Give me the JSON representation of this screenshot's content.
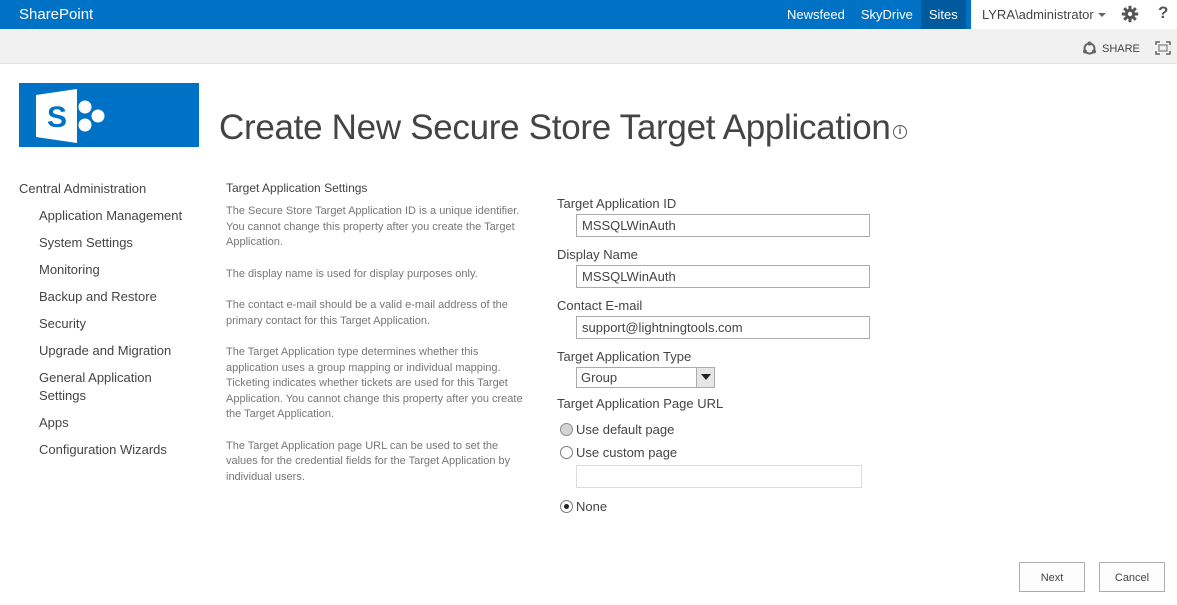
{
  "suite_bar": {
    "brand": "SharePoint",
    "links": [
      "Newsfeed",
      "SkyDrive",
      "Sites"
    ],
    "active_link": "Sites",
    "user": "LYRA\\administrator",
    "help": "?"
  },
  "ribbon": {
    "share_label": "SHARE"
  },
  "page": {
    "title": "Create New Secure Store Target Application"
  },
  "left_nav": {
    "root": "Central Administration",
    "items": [
      "Application Management",
      "System Settings",
      "Monitoring",
      "Backup and Restore",
      "Security",
      "Upgrade and Migration",
      "General Application Settings",
      "Apps",
      "Configuration Wizards"
    ]
  },
  "description": {
    "title": "Target Application Settings",
    "paragraphs": [
      "The Secure Store Target Application ID is a unique identifier. You cannot change this property after you create the Target Application.",
      "The display name is used for display purposes only.",
      "The contact e-mail should be a valid e-mail address of the primary contact for this Target Application.",
      "The Target Application type determines whether this application uses a group mapping or individual mapping. Ticketing indicates whether tickets are used for this Target Application. You cannot change this property after you create the Target Application.",
      "The Target Application page URL can be used to set the values for the credential fields for the Target Application by individual users."
    ]
  },
  "form": {
    "app_id_label": "Target Application ID",
    "app_id_value": "MSSQLWinAuth",
    "display_name_label": "Display Name",
    "display_name_value": "MSSQLWinAuth",
    "email_label": "Contact E-mail",
    "email_value": "support@lightningtools.com",
    "type_label": "Target Application Type",
    "type_value": "Group",
    "page_url_label": "Target Application Page URL",
    "radio_default": "Use default page",
    "radio_custom": "Use custom page",
    "radio_none": "None",
    "selected_radio": "None"
  },
  "buttons": {
    "next": "Next",
    "cancel": "Cancel"
  },
  "colors": {
    "suite_bar": "#0072c6",
    "suite_active": "#005a9e",
    "ribbon": "#f1f1f1"
  }
}
